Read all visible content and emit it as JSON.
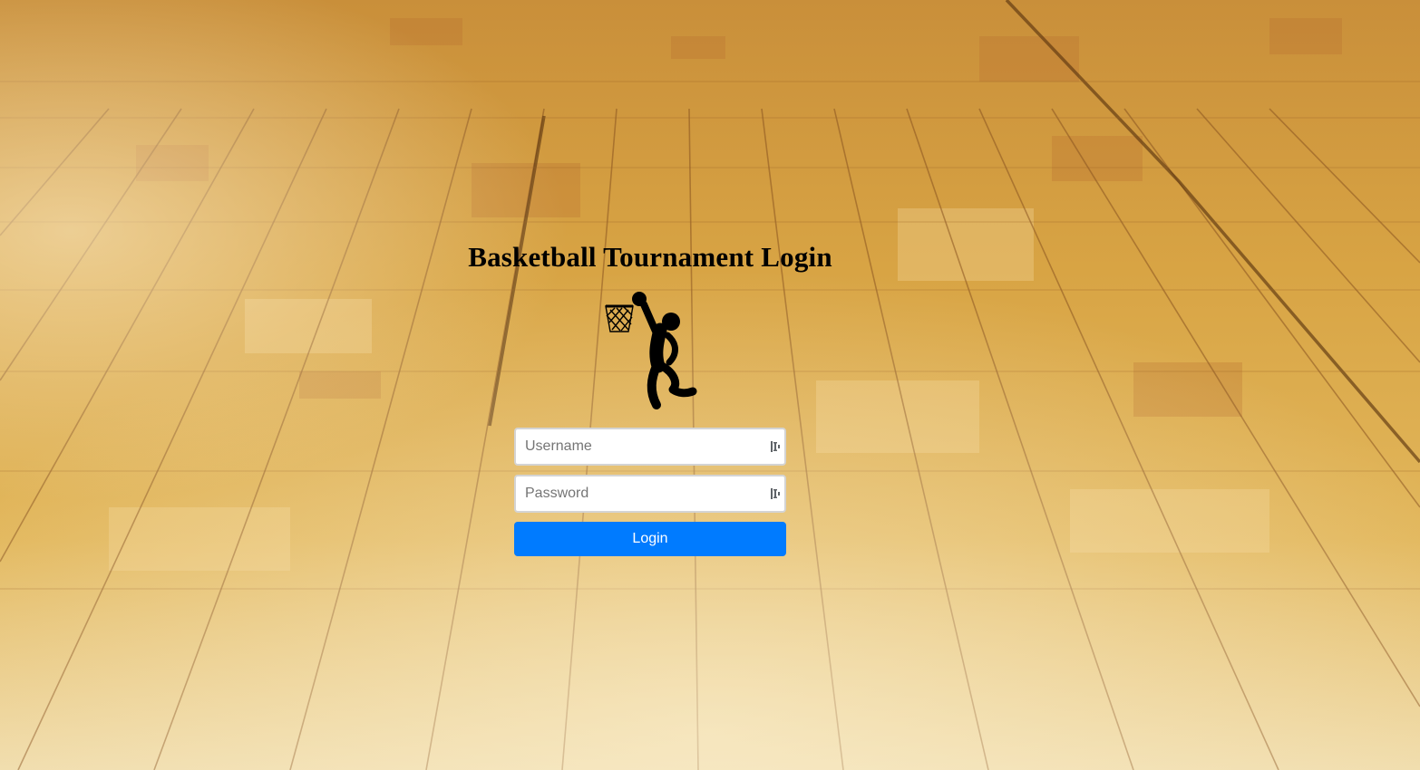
{
  "page": {
    "title": "Basketball Tournament Login"
  },
  "icons": {
    "logo": "basketball-player-dunk-icon",
    "field_addon": "password-manager-key-icon"
  },
  "form": {
    "username": {
      "placeholder": "Username",
      "value": ""
    },
    "password": {
      "placeholder": "Password",
      "value": ""
    },
    "login_label": "Login"
  },
  "colors": {
    "button_bg": "#007bff",
    "button_text": "#ffffff",
    "title_text": "#000000",
    "floor_wood": "#d9a441"
  }
}
